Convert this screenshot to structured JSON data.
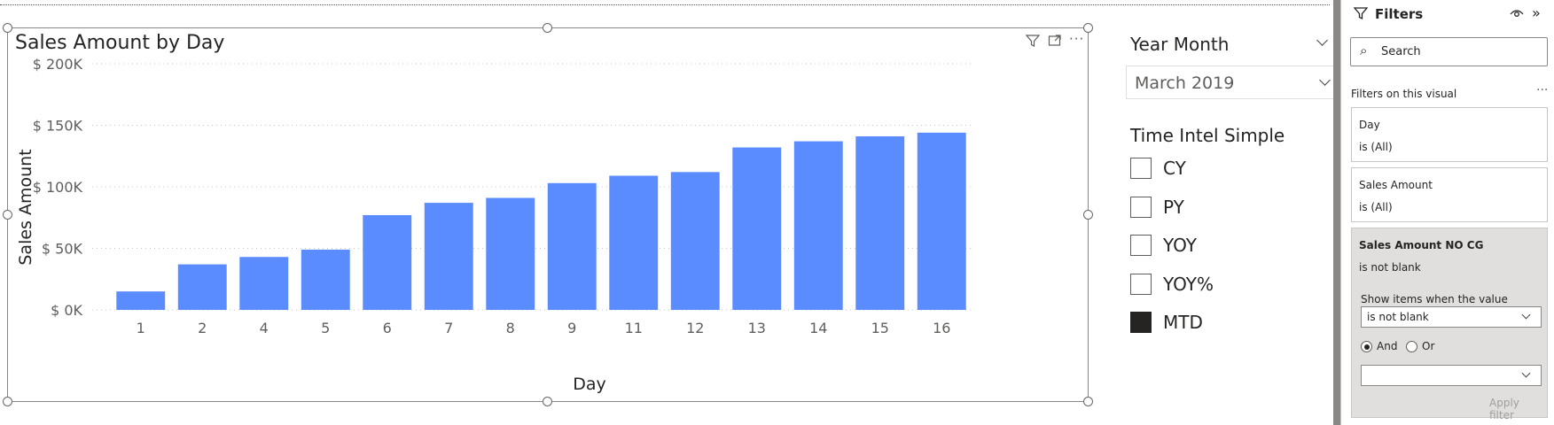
{
  "chart": {
    "title": "Sales Amount by Day",
    "icons": [
      "filter-icon",
      "focus-mode-icon",
      "more-options-icon"
    ]
  },
  "chart_data": {
    "type": "bar",
    "title": "Sales Amount by Day",
    "xlabel": "Day",
    "ylabel": "Sales Amount",
    "categories": [
      "1",
      "2",
      "4",
      "5",
      "6",
      "7",
      "8",
      "9",
      "11",
      "12",
      "13",
      "14",
      "15",
      "16"
    ],
    "values": [
      15000,
      37000,
      43000,
      49000,
      77000,
      87000,
      91000,
      103000,
      109000,
      112000,
      132000,
      137000,
      141000,
      144000
    ],
    "ylim": [
      0,
      200000
    ],
    "yticks": [
      0,
      50000,
      100000,
      150000,
      200000
    ],
    "ytick_labels": [
      "$ 0K",
      "$ 50K",
      "$ 100K",
      "$ 150K",
      "$ 200K"
    ],
    "grid": true,
    "bar_color": "#5B8CFF"
  },
  "slicer_year_month": {
    "title": "Year Month",
    "value": "March 2019"
  },
  "slicer_time_intel": {
    "title": "Time Intel Simple",
    "options": [
      {
        "label": "CY",
        "checked": false
      },
      {
        "label": "PY",
        "checked": false
      },
      {
        "label": "YOY",
        "checked": false
      },
      {
        "label": "YOY%",
        "checked": false
      },
      {
        "label": "MTD",
        "checked": true
      }
    ]
  },
  "filters": {
    "title": "Filters",
    "search_placeholder": "Search",
    "section": "Filters on this visual",
    "cards": [
      {
        "name": "Day",
        "condition": "is (All)"
      },
      {
        "name": "Sales Amount",
        "condition": "is (All)"
      }
    ],
    "active_card": {
      "name": "Sales Amount NO CG",
      "condition": "is not blank",
      "show_items_label": "Show items when the value",
      "operator": "is not blank",
      "and_label": "And",
      "or_label": "Or",
      "second_value": "",
      "apply_label": "Apply filter"
    }
  }
}
